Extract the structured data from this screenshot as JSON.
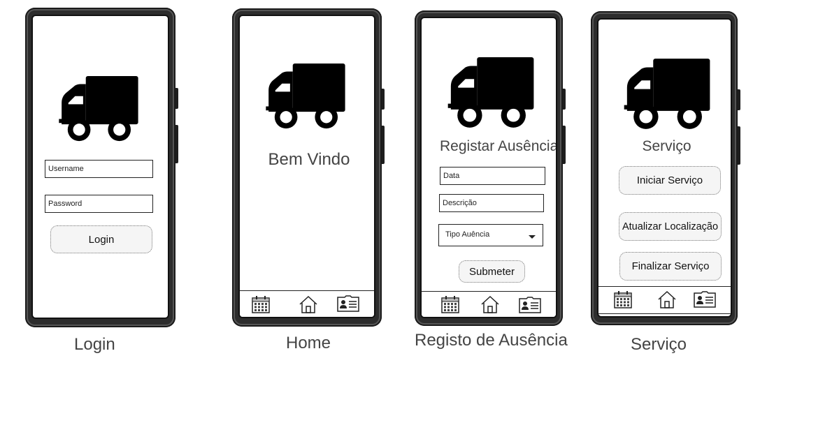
{
  "screens": {
    "login": {
      "caption": "Login",
      "username_placeholder": "Username",
      "password_placeholder": "Password",
      "login_label": "Login"
    },
    "home": {
      "caption": "Home",
      "welcome": "Bem Vindo"
    },
    "absence": {
      "caption": "Registo de Ausência",
      "title": "Registar Ausência",
      "date_placeholder": "Data",
      "description_placeholder": "Descrição",
      "type_select": "Tipo Auência",
      "submit_label": "Submeter"
    },
    "service": {
      "caption": "Serviço",
      "title": "Serviço",
      "start_label": "Iniciar Serviço",
      "update_label": "Atualizar Localização",
      "finish_label": "Finalizar Serviço"
    }
  },
  "icons": {
    "truck": "truck-icon",
    "calendar": "calendar-icon",
    "home": "home-icon",
    "contact": "contact-card-icon"
  }
}
